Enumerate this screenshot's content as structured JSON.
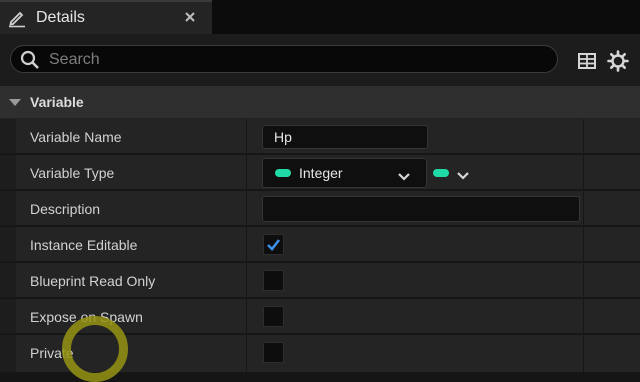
{
  "panel": {
    "tab_title": "Details",
    "tab_icon": "pencil-icon",
    "close_icon": "close-icon"
  },
  "toolbar": {
    "search_placeholder": "Search",
    "view_options_icon": "table-icon",
    "settings_icon": "gear-icon"
  },
  "category": {
    "label": "Variable",
    "expanded": true
  },
  "properties": {
    "variable_name": {
      "label": "Variable Name",
      "value": "Hp"
    },
    "variable_type": {
      "label": "Variable Type",
      "value": "Integer",
      "pin_color": "#1fd9a7"
    },
    "description": {
      "label": "Description",
      "value": ""
    },
    "instance_editable": {
      "label": "Instance Editable",
      "checked": true
    },
    "blueprint_read_only": {
      "label": "Blueprint Read Only",
      "checked": false
    },
    "expose_on_spawn": {
      "label": "Expose on Spawn",
      "checked": false
    },
    "private": {
      "label": "Private",
      "checked": false
    }
  },
  "colors": {
    "accent_check": "#3b8fe6",
    "integer_pin": "#1fd9a7",
    "cursor_highlight": "#9a9614"
  }
}
